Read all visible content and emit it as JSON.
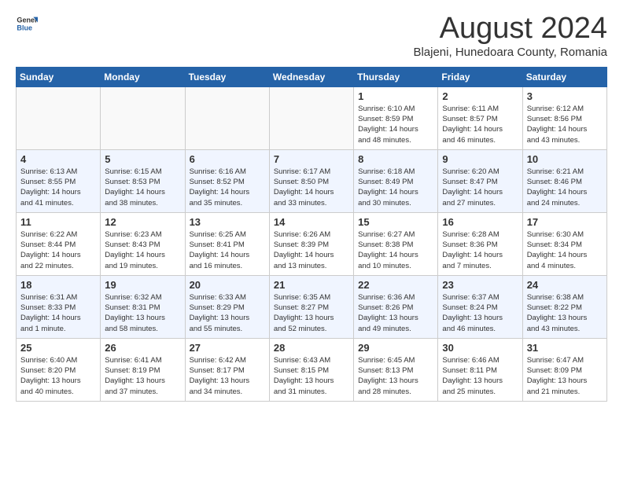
{
  "logo": {
    "general": "General",
    "blue": "Blue"
  },
  "title": "August 2024",
  "location": "Blajeni, Hunedoara County, Romania",
  "weekdays": [
    "Sunday",
    "Monday",
    "Tuesday",
    "Wednesday",
    "Thursday",
    "Friday",
    "Saturday"
  ],
  "weeks": [
    [
      {
        "day": "",
        "info": ""
      },
      {
        "day": "",
        "info": ""
      },
      {
        "day": "",
        "info": ""
      },
      {
        "day": "",
        "info": ""
      },
      {
        "day": "1",
        "info": "Sunrise: 6:10 AM\nSunset: 8:59 PM\nDaylight: 14 hours\nand 48 minutes."
      },
      {
        "day": "2",
        "info": "Sunrise: 6:11 AM\nSunset: 8:57 PM\nDaylight: 14 hours\nand 46 minutes."
      },
      {
        "day": "3",
        "info": "Sunrise: 6:12 AM\nSunset: 8:56 PM\nDaylight: 14 hours\nand 43 minutes."
      }
    ],
    [
      {
        "day": "4",
        "info": "Sunrise: 6:13 AM\nSunset: 8:55 PM\nDaylight: 14 hours\nand 41 minutes."
      },
      {
        "day": "5",
        "info": "Sunrise: 6:15 AM\nSunset: 8:53 PM\nDaylight: 14 hours\nand 38 minutes."
      },
      {
        "day": "6",
        "info": "Sunrise: 6:16 AM\nSunset: 8:52 PM\nDaylight: 14 hours\nand 35 minutes."
      },
      {
        "day": "7",
        "info": "Sunrise: 6:17 AM\nSunset: 8:50 PM\nDaylight: 14 hours\nand 33 minutes."
      },
      {
        "day": "8",
        "info": "Sunrise: 6:18 AM\nSunset: 8:49 PM\nDaylight: 14 hours\nand 30 minutes."
      },
      {
        "day": "9",
        "info": "Sunrise: 6:20 AM\nSunset: 8:47 PM\nDaylight: 14 hours\nand 27 minutes."
      },
      {
        "day": "10",
        "info": "Sunrise: 6:21 AM\nSunset: 8:46 PM\nDaylight: 14 hours\nand 24 minutes."
      }
    ],
    [
      {
        "day": "11",
        "info": "Sunrise: 6:22 AM\nSunset: 8:44 PM\nDaylight: 14 hours\nand 22 minutes."
      },
      {
        "day": "12",
        "info": "Sunrise: 6:23 AM\nSunset: 8:43 PM\nDaylight: 14 hours\nand 19 minutes."
      },
      {
        "day": "13",
        "info": "Sunrise: 6:25 AM\nSunset: 8:41 PM\nDaylight: 14 hours\nand 16 minutes."
      },
      {
        "day": "14",
        "info": "Sunrise: 6:26 AM\nSunset: 8:39 PM\nDaylight: 14 hours\nand 13 minutes."
      },
      {
        "day": "15",
        "info": "Sunrise: 6:27 AM\nSunset: 8:38 PM\nDaylight: 14 hours\nand 10 minutes."
      },
      {
        "day": "16",
        "info": "Sunrise: 6:28 AM\nSunset: 8:36 PM\nDaylight: 14 hours\nand 7 minutes."
      },
      {
        "day": "17",
        "info": "Sunrise: 6:30 AM\nSunset: 8:34 PM\nDaylight: 14 hours\nand 4 minutes."
      }
    ],
    [
      {
        "day": "18",
        "info": "Sunrise: 6:31 AM\nSunset: 8:33 PM\nDaylight: 14 hours\nand 1 minute."
      },
      {
        "day": "19",
        "info": "Sunrise: 6:32 AM\nSunset: 8:31 PM\nDaylight: 13 hours\nand 58 minutes."
      },
      {
        "day": "20",
        "info": "Sunrise: 6:33 AM\nSunset: 8:29 PM\nDaylight: 13 hours\nand 55 minutes."
      },
      {
        "day": "21",
        "info": "Sunrise: 6:35 AM\nSunset: 8:27 PM\nDaylight: 13 hours\nand 52 minutes."
      },
      {
        "day": "22",
        "info": "Sunrise: 6:36 AM\nSunset: 8:26 PM\nDaylight: 13 hours\nand 49 minutes."
      },
      {
        "day": "23",
        "info": "Sunrise: 6:37 AM\nSunset: 8:24 PM\nDaylight: 13 hours\nand 46 minutes."
      },
      {
        "day": "24",
        "info": "Sunrise: 6:38 AM\nSunset: 8:22 PM\nDaylight: 13 hours\nand 43 minutes."
      }
    ],
    [
      {
        "day": "25",
        "info": "Sunrise: 6:40 AM\nSunset: 8:20 PM\nDaylight: 13 hours\nand 40 minutes."
      },
      {
        "day": "26",
        "info": "Sunrise: 6:41 AM\nSunset: 8:19 PM\nDaylight: 13 hours\nand 37 minutes."
      },
      {
        "day": "27",
        "info": "Sunrise: 6:42 AM\nSunset: 8:17 PM\nDaylight: 13 hours\nand 34 minutes."
      },
      {
        "day": "28",
        "info": "Sunrise: 6:43 AM\nSunset: 8:15 PM\nDaylight: 13 hours\nand 31 minutes."
      },
      {
        "day": "29",
        "info": "Sunrise: 6:45 AM\nSunset: 8:13 PM\nDaylight: 13 hours\nand 28 minutes."
      },
      {
        "day": "30",
        "info": "Sunrise: 6:46 AM\nSunset: 8:11 PM\nDaylight: 13 hours\nand 25 minutes."
      },
      {
        "day": "31",
        "info": "Sunrise: 6:47 AM\nSunset: 8:09 PM\nDaylight: 13 hours\nand 21 minutes."
      }
    ]
  ]
}
